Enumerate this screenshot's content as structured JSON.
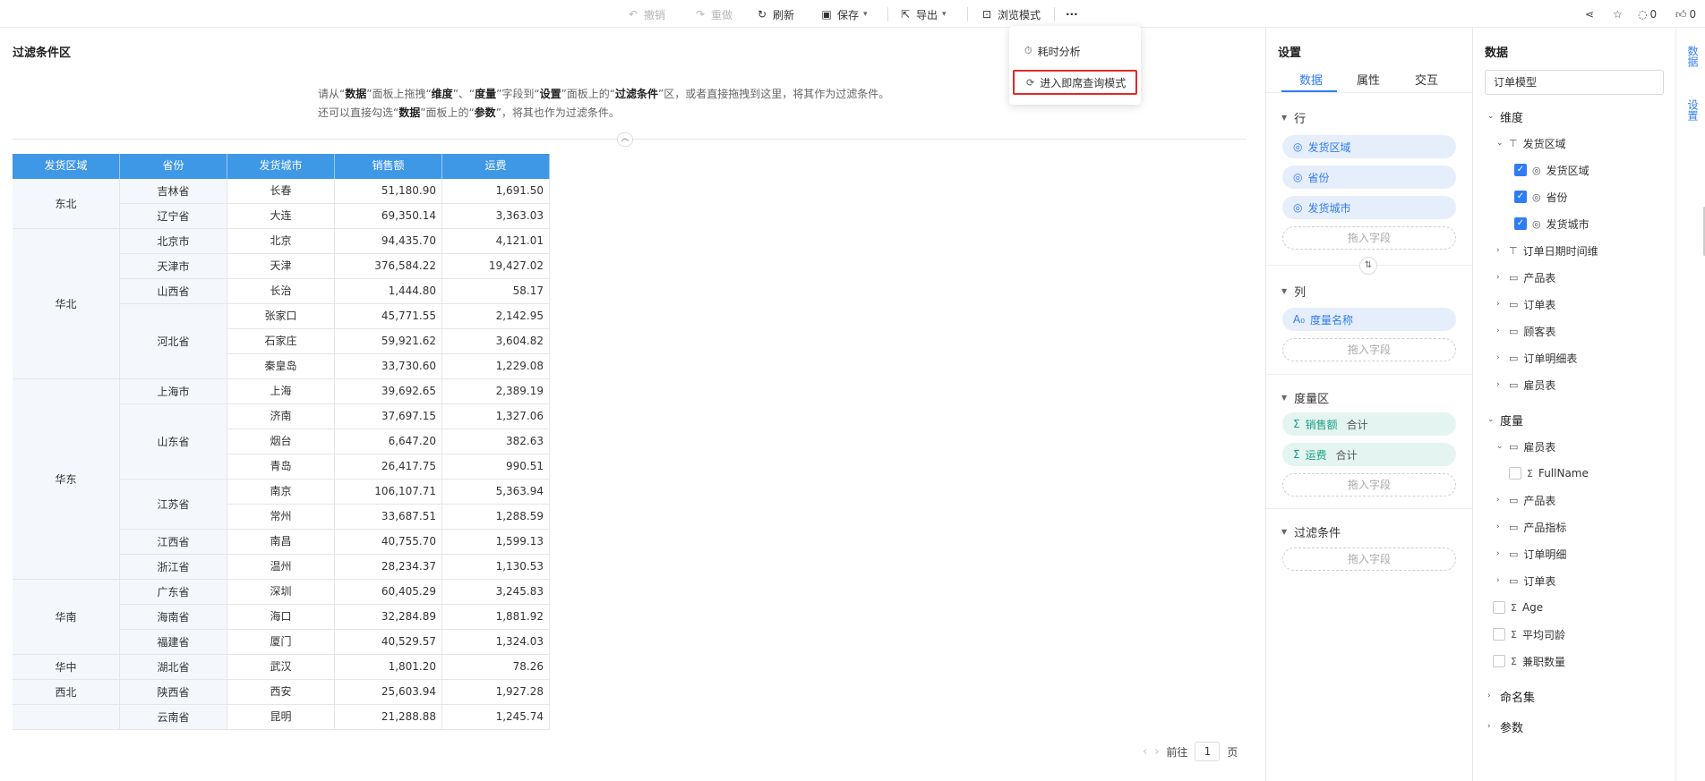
{
  "toolbar": {
    "undo": "撤销",
    "redo": "重做",
    "refresh": "刷新",
    "save": "保存",
    "export": "导出",
    "browse": "浏览模式",
    "more": "···",
    "comment_count": "0",
    "like_count": "0"
  },
  "more_menu": {
    "timing": "耗时分析",
    "adhoc": "进入即席查询模式"
  },
  "filter_area": {
    "title": "过滤条件区",
    "hint_line1": [
      "请从“",
      "数据",
      "”面板上拖拽“",
      "维度",
      "”、“",
      "度量",
      "”字段到“",
      "设置",
      "”面板上的“",
      "过滤条件",
      "”区，或者直接拖拽到这里，将其作为过滤条件。"
    ],
    "hint_line2": [
      "还可以直接勾选“",
      "数据",
      "”面板上的“",
      "参数",
      "”，将其也作为过滤条件。"
    ]
  },
  "table": {
    "headers": [
      "发货区域",
      "省份",
      "发货城市",
      "销售额",
      "运费"
    ],
    "rows": [
      [
        "东北",
        "吉林省",
        "长春",
        "51,180.90",
        "1,691.50"
      ],
      [
        "东北",
        "辽宁省",
        "大连",
        "69,350.14",
        "3,363.03"
      ],
      [
        "华北",
        "北京市",
        "北京",
        "94,435.70",
        "4,121.01"
      ],
      [
        "华北",
        "天津市",
        "天津",
        "376,584.22",
        "19,427.02"
      ],
      [
        "华北",
        "山西省",
        "长治",
        "1,444.80",
        "58.17"
      ],
      [
        "华北",
        "河北省",
        "张家口",
        "45,771.55",
        "2,142.95"
      ],
      [
        "华北",
        "河北省",
        "石家庄",
        "59,921.62",
        "3,604.82"
      ],
      [
        "华北",
        "河北省",
        "秦皇岛",
        "33,730.60",
        "1,229.08"
      ],
      [
        "华东",
        "上海市",
        "上海",
        "39,692.65",
        "2,389.19"
      ],
      [
        "华东",
        "山东省",
        "济南",
        "37,697.15",
        "1,327.06"
      ],
      [
        "华东",
        "山东省",
        "烟台",
        "6,647.20",
        "382.63"
      ],
      [
        "华东",
        "山东省",
        "青岛",
        "26,417.75",
        "990.51"
      ],
      [
        "华东",
        "江苏省",
        "南京",
        "106,107.71",
        "5,363.94"
      ],
      [
        "华东",
        "江苏省",
        "常州",
        "33,687.51",
        "1,288.59"
      ],
      [
        "华东",
        "江西省",
        "南昌",
        "40,755.70",
        "1,599.13"
      ],
      [
        "华东",
        "浙江省",
        "温州",
        "28,234.37",
        "1,130.53"
      ],
      [
        "华南",
        "广东省",
        "深圳",
        "60,405.29",
        "3,245.83"
      ],
      [
        "华南",
        "海南省",
        "海口",
        "32,284.89",
        "1,881.92"
      ],
      [
        "华南",
        "福建省",
        "厦门",
        "40,529.57",
        "1,324.03"
      ],
      [
        "华中",
        "湖北省",
        "武汉",
        "1,801.20",
        "78.26"
      ],
      [
        "西北",
        "陕西省",
        "西安",
        "25,603.94",
        "1,927.28"
      ],
      [
        "",
        "云南省",
        "昆明",
        "21,288.88",
        "1,245.74"
      ]
    ]
  },
  "pager": {
    "prefix": "前往",
    "page": "1",
    "suffix": "页"
  },
  "settings": {
    "title": "设置",
    "tabs": [
      "数据",
      "属性",
      "交互"
    ],
    "rows_title": "行",
    "rows": [
      "发货区域",
      "省份",
      "发货城市"
    ],
    "drop_label": "拖入字段",
    "cols_title": "列",
    "cols": [
      "度量名称"
    ],
    "measure_title": "度量区",
    "measures": [
      {
        "name": "销售额",
        "agg": "合计"
      },
      {
        "name": "运费",
        "agg": "合计"
      }
    ],
    "filter_title": "过滤条件"
  },
  "data_panel": {
    "title": "数据",
    "model": "订单模型",
    "dimension_title": "维度",
    "dim_items": [
      "发货区域",
      "发货区域",
      "省份",
      "发货城市",
      "订单日期时间维",
      "产品表",
      "订单表",
      "顾客表",
      "订单明细表",
      "雇员表"
    ],
    "measure_title": "度量",
    "meas_items": [
      "雇员表",
      "FullName",
      "产品表",
      "产品指标",
      "订单明细",
      "订单表",
      "Age",
      "平均司龄",
      "兼职数量"
    ],
    "named_set": "命名集",
    "params": "参数"
  },
  "rail": {
    "data_tab": "数据",
    "settings_tab": "设置"
  },
  "colors": {
    "header_blue": "#3f98e6",
    "accent": "#2f7cf6",
    "highlight_red": "#e02a2a",
    "measure_green": "#1c9e83"
  }
}
